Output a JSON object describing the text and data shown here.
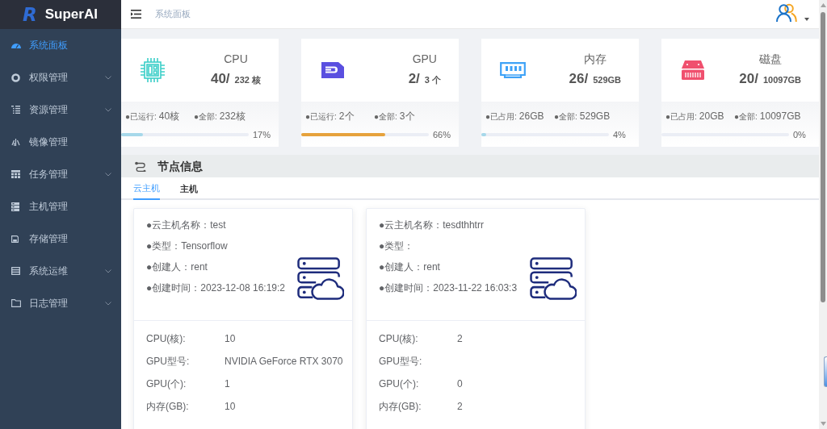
{
  "sidebar": {
    "logo_mark": "R",
    "title": "SuperAI",
    "items": [
      {
        "label": "系统面板",
        "selected": true,
        "submenu": false
      },
      {
        "label": "权限管理",
        "selected": false,
        "submenu": true
      },
      {
        "label": "资源管理",
        "selected": false,
        "submenu": true
      },
      {
        "label": "镜像管理",
        "selected": false,
        "submenu": false
      },
      {
        "label": "任务管理",
        "selected": false,
        "submenu": true
      },
      {
        "label": "主机管理",
        "selected": false,
        "submenu": false
      },
      {
        "label": "存储管理",
        "selected": false,
        "submenu": false
      },
      {
        "label": "系统运维",
        "selected": false,
        "submenu": true
      },
      {
        "label": "日志管理",
        "selected": false,
        "submenu": true
      }
    ]
  },
  "header": {
    "breadcrumb": "系统面板"
  },
  "stats": [
    {
      "title": "CPU",
      "value": "40/",
      "total": "232 核",
      "used_label": "●已运行:",
      "used": "40核",
      "all_label": "●全部:",
      "all": "232核",
      "level": 0.17,
      "percent": "17%",
      "color": "#a6d8ea"
    },
    {
      "title": "GPU",
      "value": "2/",
      "total": "3 个",
      "used_label": "●已运行:",
      "used": "2个",
      "all_label": "●全部:",
      "all": "3个",
      "level": 0.66,
      "percent": "66%",
      "color": "#e6a23c"
    },
    {
      "title": "内存",
      "value": "26/",
      "total": "529GB",
      "used_label": "●已占用:",
      "used": "26GB",
      "all_label": "●全部:",
      "all": "529GB",
      "level": 0.04,
      "percent": "4%",
      "color": "#a6d8ea"
    },
    {
      "title": "磁盘",
      "value": "20/",
      "total": "10097GB",
      "used_label": "●已占用:",
      "used": "20GB",
      "all_label": "●全部:",
      "all": "10097GB",
      "level": 0,
      "percent": "0%"
    }
  ],
  "nodes": {
    "title": "节点信息",
    "tabs": [
      {
        "label": "云主机",
        "selected": true
      },
      {
        "label": "主机",
        "selected": false
      }
    ],
    "cards": [
      {
        "info": [
          "●云主机名称：test",
          "●类型：Tensorflow",
          "●创建人：rent",
          "●创建时间：2023-12-08 16:19:2"
        ],
        "specs": [
          {
            "label": "CPU(核):",
            "value": "10"
          },
          {
            "label": "GPU型号:",
            "value": "NVIDIA GeForce RTX 3070"
          },
          {
            "label": "GPU(个):",
            "value": "1"
          },
          {
            "label": "内存(GB):",
            "value": "10"
          }
        ]
      },
      {
        "info": [
          "●云主机名称：tesdthhtrr",
          "●类型：",
          "●创建人：rent",
          "●创建时间：2023-11-22 16:03:3"
        ],
        "specs": [
          {
            "label": "CPU(核):",
            "value": "2"
          },
          {
            "label": "GPU型号:"
          },
          {
            "label": "GPU(个):",
            "value": "0"
          },
          {
            "label": "内存(GB):",
            "value": "2"
          }
        ]
      }
    ]
  }
}
